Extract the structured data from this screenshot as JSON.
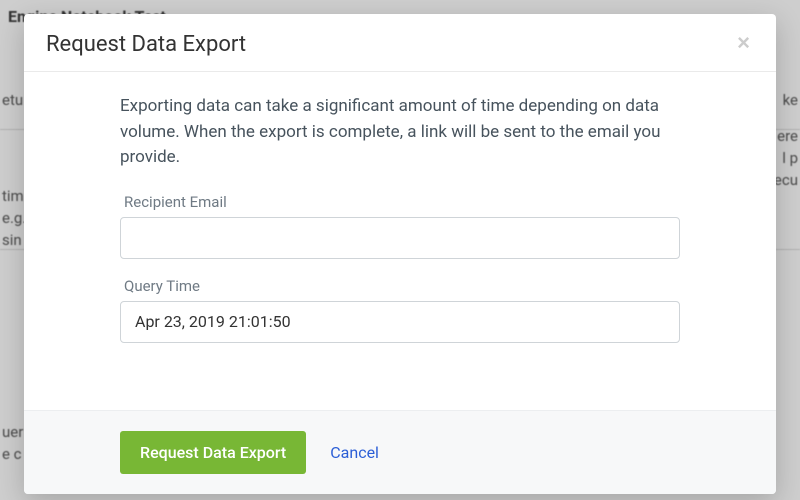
{
  "background": {
    "heading": "Engine Notebook Test",
    "frag1": "etu",
    "frag2": "tim",
    "frag3": "e.g.",
    "frag4": "sin",
    "frag5": "uer",
    "frag6": "e c",
    "frag_r1": "ke",
    "frag_r2": "ere",
    "frag_r3": "l p",
    "frag_r4": "ecu"
  },
  "modal": {
    "title": "Request Data Export",
    "intro": "Exporting data can take a significant amount of time depending on data volume. When the export is complete, a link will be sent to the email you provide.",
    "fields": {
      "email_label": "Recipient Email",
      "email_value": "",
      "time_label": "Query Time",
      "time_value": "Apr 23, 2019 21:01:50"
    },
    "submit_label": "Request Data Export",
    "cancel_label": "Cancel",
    "close_glyph": "×"
  }
}
